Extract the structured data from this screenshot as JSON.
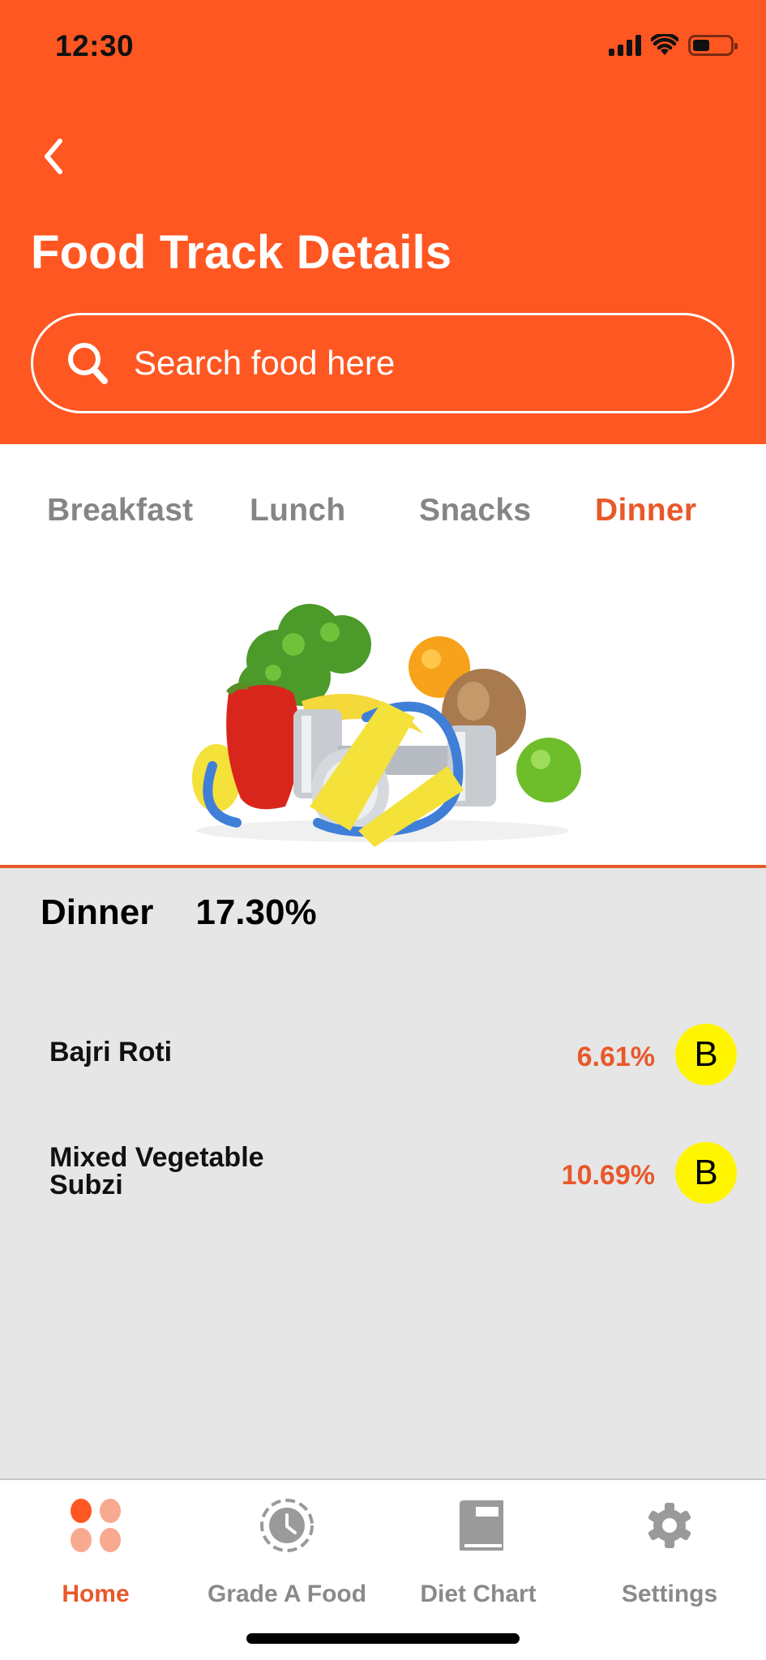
{
  "status_bar": {
    "time": "12:30",
    "icons": [
      "signal-icon",
      "wifi-icon",
      "battery-icon"
    ]
  },
  "header": {
    "back_icon": "chevron-left-icon",
    "title": "Food Track Details",
    "search": {
      "icon": "search-icon",
      "placeholder": "Search food here",
      "value": ""
    }
  },
  "colors": {
    "brand": "#FF5722",
    "accent_text": "#E8582A",
    "inactive_text": "#858585",
    "content_bg": "#E6E6E6",
    "grade_badge": "#FFF500"
  },
  "tabs": [
    {
      "label": "Breakfast",
      "active": false
    },
    {
      "label": "Lunch",
      "active": false
    },
    {
      "label": "Snacks",
      "active": false
    },
    {
      "label": "Dinner",
      "active": true
    }
  ],
  "hero_image": "fitness-food-illustration",
  "summary": {
    "meal": "Dinner",
    "percentage": "17.30%"
  },
  "foods": [
    {
      "name": "Bajri Roti",
      "percentage": "6.61%",
      "grade": "B"
    },
    {
      "name": "Mixed Vegetable\nSubzi",
      "percentage": "10.69%",
      "grade": "B"
    }
  ],
  "bottom_nav": [
    {
      "label": "Home",
      "icon": "home-dots-icon",
      "active": true
    },
    {
      "label": "Grade A Food",
      "icon": "clock-icon",
      "active": false
    },
    {
      "label": "Diet Chart",
      "icon": "book-icon",
      "active": false
    },
    {
      "label": "Settings",
      "icon": "gear-icon",
      "active": false
    }
  ]
}
